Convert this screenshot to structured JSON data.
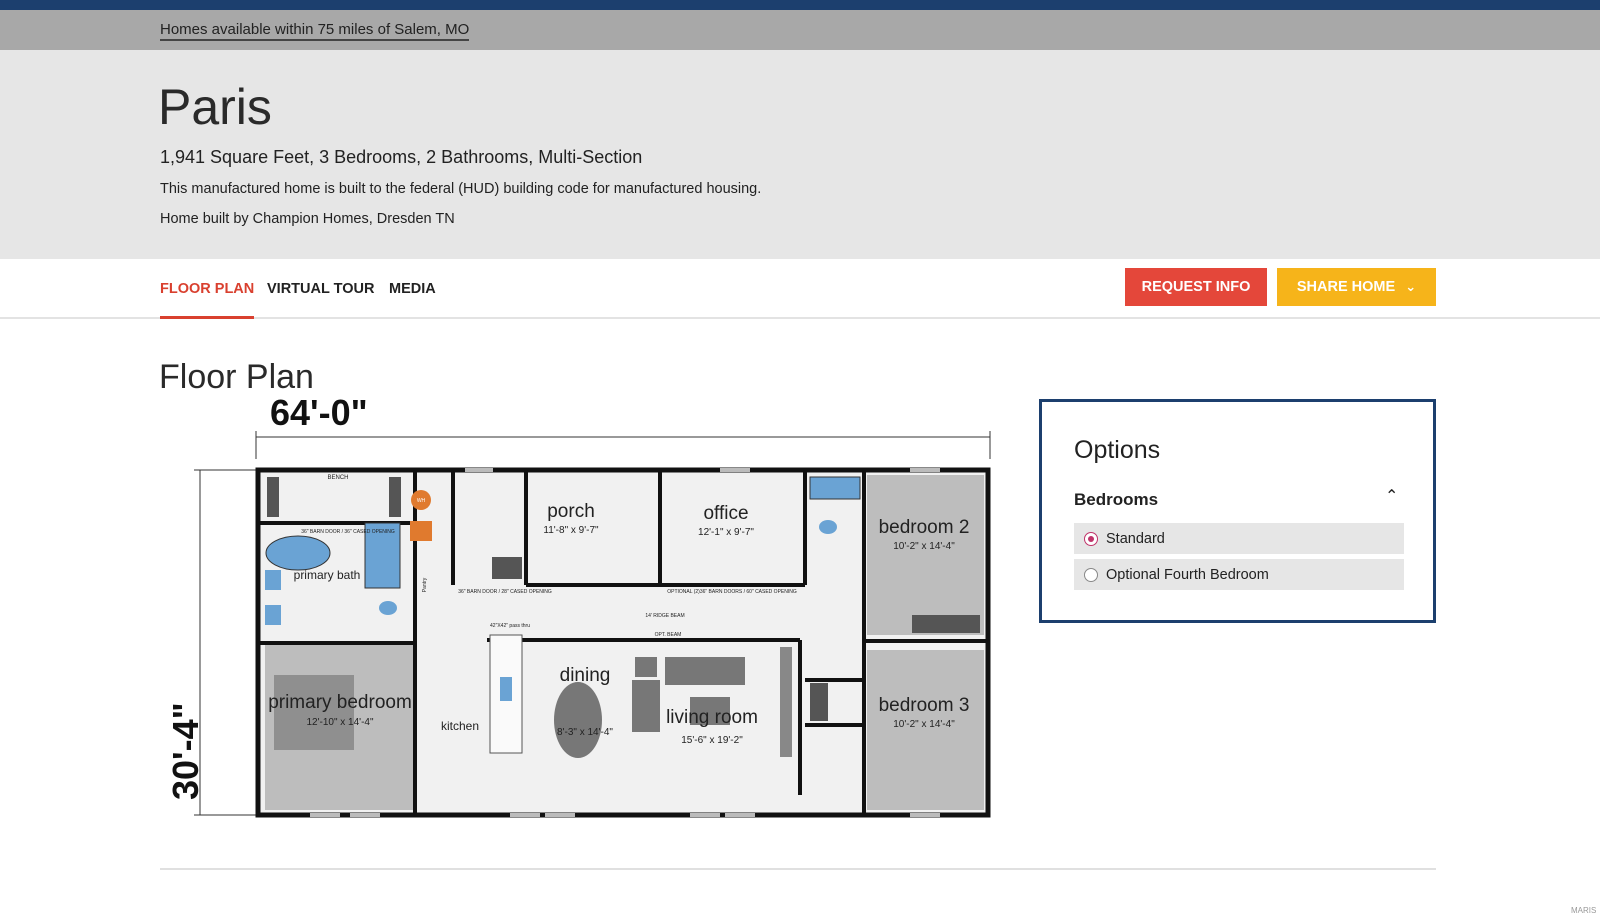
{
  "location_bar": {
    "text": "Homes available within 75 miles of Salem, MO"
  },
  "home": {
    "name": "Paris",
    "specs": "1,941 Square Feet, 3 Bedrooms, 2 Bathrooms, Multi-Section",
    "hud_note": "This manufactured home is built to the federal (HUD) building code for manufactured housing.",
    "builder": "Home built by Champion Homes, Dresden TN"
  },
  "tabs": [
    {
      "label": "FLOOR PLAN",
      "active": true
    },
    {
      "label": "VIRTUAL TOUR",
      "active": false
    },
    {
      "label": "MEDIA",
      "active": false
    }
  ],
  "actions": {
    "request_info": "REQUEST INFO",
    "share_home": "SHARE HOME"
  },
  "floor_plan": {
    "heading": "Floor Plan",
    "width_dim": "64'-0\"",
    "depth_dim": "30'-4\"",
    "rooms": {
      "porch": {
        "name": "porch",
        "size": "11'-8\" x 9'-7\""
      },
      "office": {
        "name": "office",
        "size": "12'-1\" x 9'-7\""
      },
      "bedroom2": {
        "name": "bedroom 2",
        "size": "10'-2\" x 14'-4\""
      },
      "primary_bath": {
        "name": "primary bath"
      },
      "primary_bedroom": {
        "name": "primary bedroom",
        "size": "12'-10\" x 14'-4\""
      },
      "kitchen": {
        "name": "kitchen"
      },
      "dining": {
        "name": "dining",
        "size": "8'-3\" x 14'-4\""
      },
      "living_room": {
        "name": "living room",
        "size": "15'-6\" x 19'-2\""
      },
      "bedroom3": {
        "name": "bedroom 3",
        "size": "10'-2\" x 14'-4\""
      }
    },
    "small_labels": {
      "bench": "BENCH",
      "barn_door_1": "36\" BARN DOOR / 36\" CASED OPENING",
      "barn_door_2": "36\" BARN DOOR / 28\" CASED OPENING",
      "optional_barn": "OPTIONAL (2)36\" BARN DOORS / 60\" CASED OPENING",
      "ridge_beam": "14' RIDGE BEAM",
      "pass_thru": "42\"X42\" pass thru",
      "opt_beam": "OPT. BEAM",
      "wh": "WH",
      "pantry": "Pantry"
    }
  },
  "options_panel": {
    "title": "Options",
    "group": "Bedrooms",
    "choices": [
      {
        "label": "Standard",
        "selected": true
      },
      {
        "label": "Optional Fourth Bedroom",
        "selected": false
      }
    ]
  },
  "watermark": "MARIS"
}
